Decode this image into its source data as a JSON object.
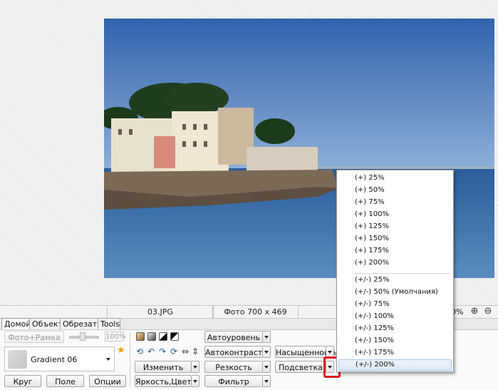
{
  "status": {
    "filename": "03.JPG",
    "photo_info": "Фото 700 x 469",
    "zoom": "0%"
  },
  "tabs": [
    "Домой",
    "Объект",
    "Обрезать",
    "Tools"
  ],
  "left": {
    "photo_frame_label": "Фото+Рамка",
    "percent": "100%",
    "gradient_label": "Gradient 06",
    "circle_label": "Круг",
    "field_label": "Поле",
    "options_label": "Опции"
  },
  "mid": {
    "change_label": "Изменить",
    "brightness_label": "Яркость,Цвет"
  },
  "right": {
    "autolevel_label": "Автоуровень",
    "autocontrast_label": "Автоконтраст",
    "sharpness_label": "Резкость",
    "filter_label": "Фильтр",
    "saturation_label": "Насыщенность",
    "highlight_label": "Подсветка"
  },
  "menu": {
    "items": [
      "(+) 25%",
      "(+) 50%",
      "(+) 75%",
      "(+) 100%",
      "(+) 125%",
      "(+) 150%",
      "(+) 175%",
      "(+) 200%",
      "(+/-) 25%",
      "(+/-) 50% (Умолчания)",
      "(+/-) 75%",
      "(+/-) 100%",
      "(+/-) 125%",
      "(+/-) 150%",
      "(+/-) 175%",
      "(+/-) 200%"
    ],
    "highlighted_index": 15
  },
  "colors": {
    "accent_red": "#e0141e",
    "sky": "#3f6fb8",
    "sea": "#2f69a6"
  },
  "icons": [
    "zoom-in-icon",
    "zoom-out-icon",
    "star-icon",
    "rotate-left-icon",
    "rotate-right-icon",
    "flip-horizontal-icon",
    "flip-vertical-icon"
  ]
}
